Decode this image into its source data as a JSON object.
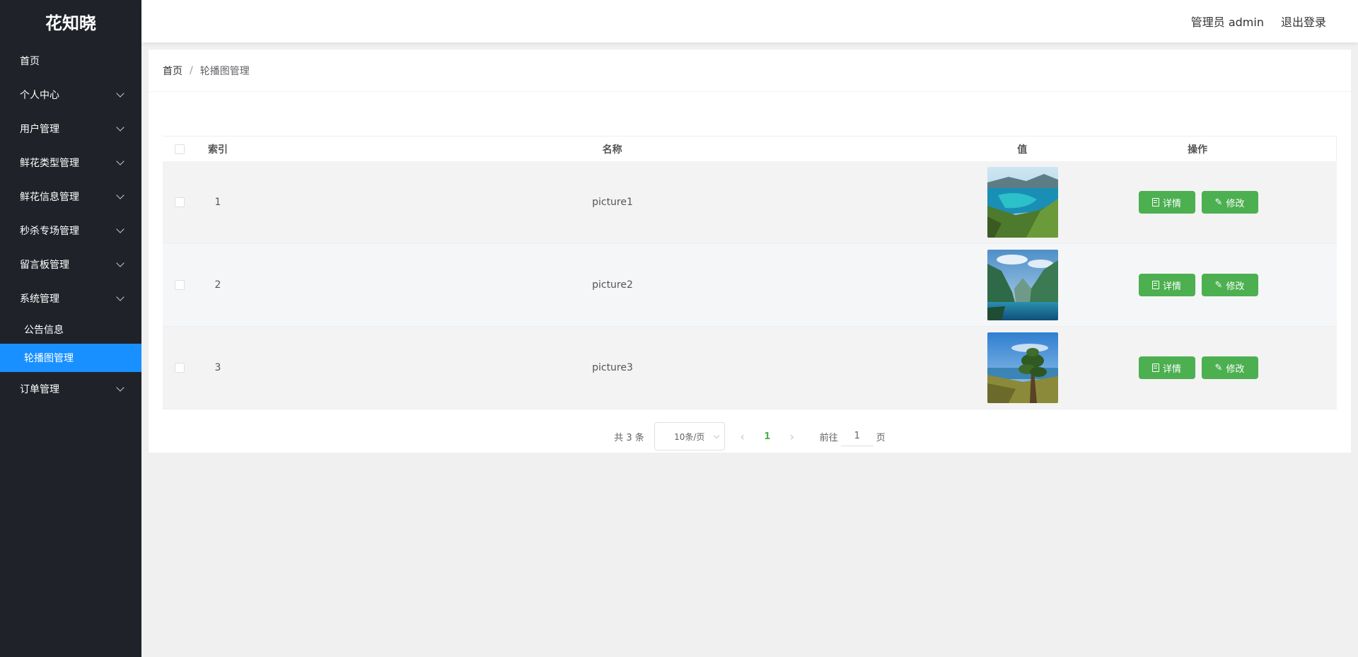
{
  "app": {
    "logo": "花知晓"
  },
  "sidebar": {
    "items": [
      {
        "label": "首页"
      },
      {
        "label": "个人中心"
      },
      {
        "label": "用户管理"
      },
      {
        "label": "鲜花类型管理"
      },
      {
        "label": "鲜花信息管理"
      },
      {
        "label": "秒杀专场管理"
      },
      {
        "label": "留言板管理"
      },
      {
        "label": "系统管理"
      },
      {
        "label": "订单管理"
      }
    ],
    "system_sub": [
      {
        "label": "公告信息"
      },
      {
        "label": "轮播图管理"
      }
    ]
  },
  "header": {
    "user": "管理员 admin",
    "logout": "退出登录"
  },
  "breadcrumb": {
    "home": "首页",
    "separator": "/",
    "current": "轮播图管理"
  },
  "table": {
    "headers": {
      "index": "索引",
      "name": "名称",
      "value": "值",
      "actions": "操作"
    },
    "rows": [
      {
        "index": "1",
        "name": "picture1",
        "image": "coastal-mountain-lagoon"
      },
      {
        "index": "2",
        "name": "picture2",
        "image": "fjord-lake-cliffs"
      },
      {
        "index": "3",
        "name": "picture3",
        "image": "pine-tree-hillside"
      }
    ],
    "detail_label": "详情",
    "edit_label": "修改"
  },
  "pagination": {
    "total": "共 3 条",
    "page_size": "10条/页",
    "current_page": "1",
    "goto_label": "前往",
    "goto_value": "1",
    "page_suffix": "页"
  },
  "colors": {
    "sidebar_bg": "#1f2329",
    "active": "#1890ff",
    "button": "#4caf50"
  }
}
